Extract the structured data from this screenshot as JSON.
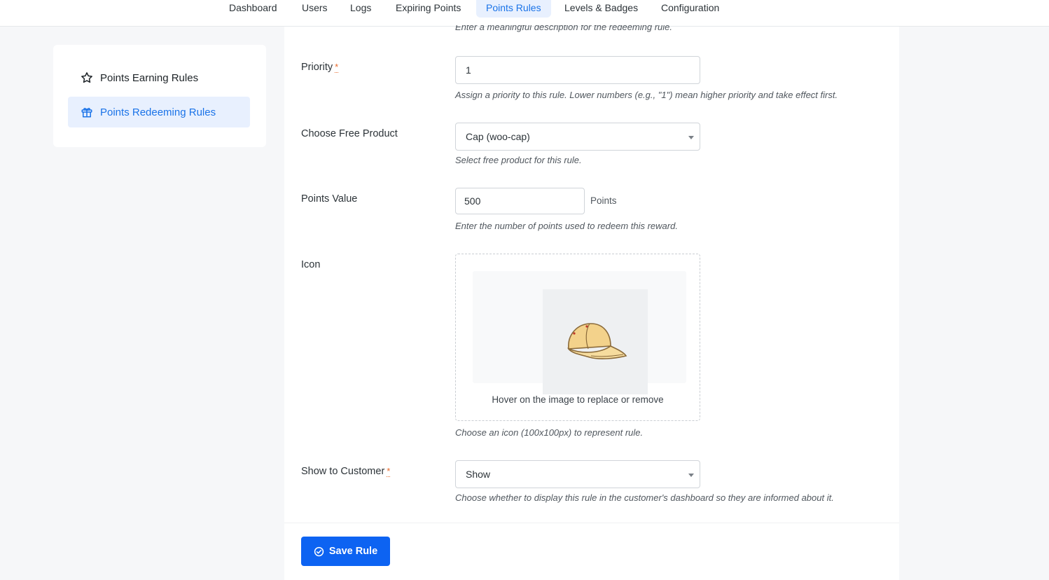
{
  "nav": {
    "tabs": [
      {
        "label": "Dashboard"
      },
      {
        "label": "Users"
      },
      {
        "label": "Logs"
      },
      {
        "label": "Expiring Points"
      },
      {
        "label": "Points Rules"
      },
      {
        "label": "Levels & Badges"
      },
      {
        "label": "Configuration"
      }
    ],
    "active_tab": "Points Rules"
  },
  "sidebar": {
    "items": [
      {
        "label": "Points Earning Rules",
        "icon": "star-icon"
      },
      {
        "label": "Points Redeeming Rules",
        "icon": "gift-icon",
        "active": true
      }
    ]
  },
  "form": {
    "description_help": "Enter a meaningful description for the redeeming rule.",
    "priority": {
      "label": "Priority",
      "required_mark": "*",
      "value": "1",
      "help": "Assign a priority to this rule. Lower numbers (e.g., \"1\") mean higher priority and take effect first."
    },
    "free_product": {
      "label": "Choose Free Product",
      "selected": "Cap (woo-cap)",
      "help": "Select free product for this rule."
    },
    "points_value": {
      "label": "Points Value",
      "value": "500",
      "unit": "Points",
      "help": "Enter the number of points used to redeem this reward."
    },
    "icon": {
      "label": "Icon",
      "hint": "Hover on the image to replace or remove",
      "help": "Choose an icon (100x100px) to represent rule."
    },
    "show_to_customer": {
      "label": "Show to Customer",
      "required_mark": "*",
      "selected": "Show",
      "help": "Choose whether to display this rule in the customer's dashboard so they are informed about it."
    }
  },
  "actions": {
    "save_label": "Save Rule"
  },
  "colors": {
    "accent": "#0d63f2",
    "active_bg": "#e8f0fe",
    "required": "#e86a2c"
  }
}
